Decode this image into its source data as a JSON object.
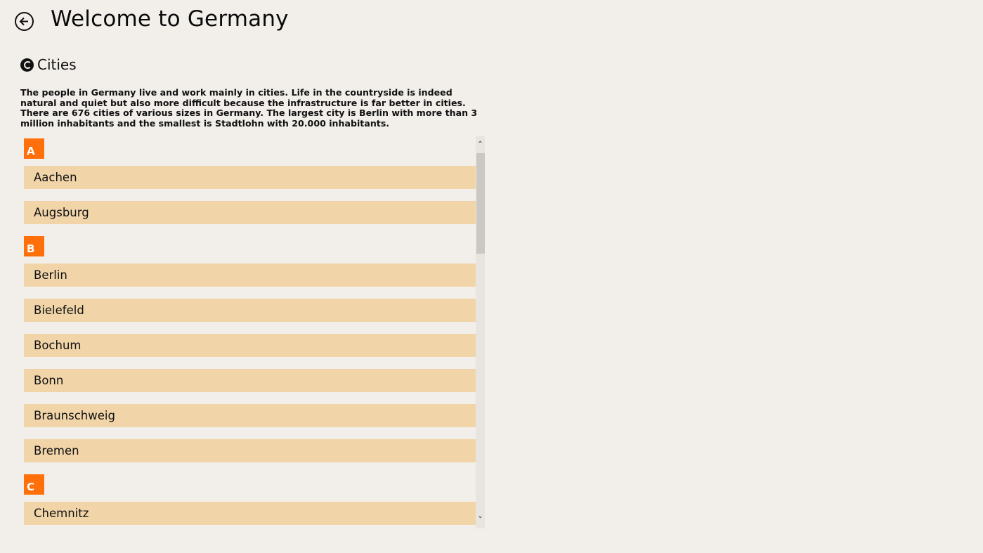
{
  "header": {
    "back_icon": "arrow-left-circle-icon",
    "title": "Welcome to Germany"
  },
  "section": {
    "icon": "c-circle-icon",
    "title": "Cities",
    "description": "The people in Germany live and work mainly in cities. Life in the countryside is indeed natural and quiet but also more difficult because the infrastructure is far better in cities. There are 676 cities of various sizes in Germany. The largest city is Berlin with more than 3 million inhabitants and the smallest is Stadtlohn with 20.000 inhabitants."
  },
  "groups": [
    {
      "letter": "A",
      "cities": [
        "Aachen",
        "Augsburg"
      ]
    },
    {
      "letter": "B",
      "cities": [
        "Berlin",
        "Bielefeld",
        "Bochum",
        "Bonn",
        "Braunschweig",
        "Bremen"
      ]
    },
    {
      "letter": "C",
      "cities": [
        "Chemnitz"
      ]
    }
  ],
  "scrollbar": {
    "up_icon": "chevron-up-icon",
    "down_icon": "chevron-down-icon"
  },
  "colors": {
    "background": "#f2efea",
    "group_header": "#ff6f0a",
    "list_item": "#f1d5a9",
    "text": "#111111"
  }
}
